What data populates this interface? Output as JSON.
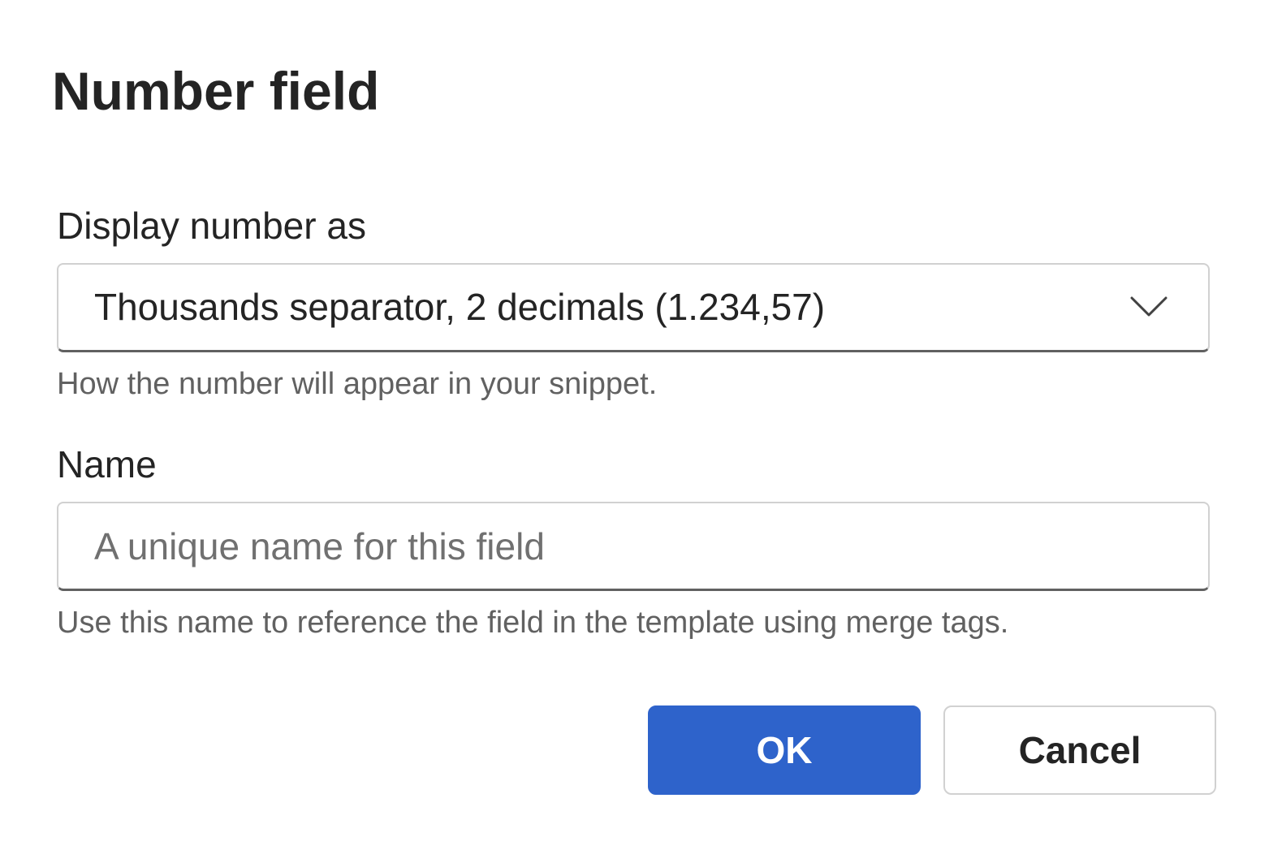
{
  "dialog": {
    "title": "Number field",
    "display_field": {
      "label": "Display number as",
      "selected_value": "Thousands separator, 2 decimals (1.234,57)",
      "hint": "How the number will appear in your snippet.",
      "icon": "chevron-down-icon"
    },
    "name_field": {
      "label": "Name",
      "value": "",
      "placeholder": "A unique name for this field",
      "hint": "Use this name to reference the field in the template using merge tags."
    },
    "buttons": {
      "ok_label": "OK",
      "cancel_label": "Cancel"
    },
    "colors": {
      "primary": "#2e63cb",
      "text": "#242424",
      "hint_text": "#616161",
      "border": "#d1d1d1"
    }
  }
}
